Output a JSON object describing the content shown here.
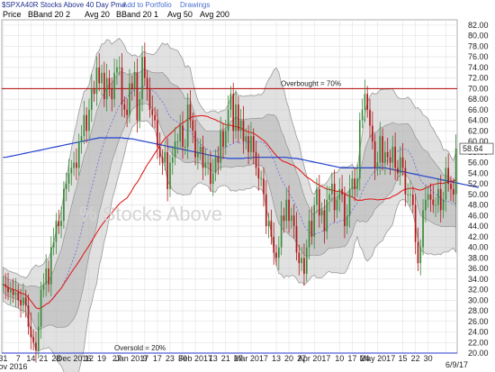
{
  "header": {
    "title": "$SPXA40R Stocks Above 40 Day Pma",
    "links": [
      "Add to Portfolio",
      "Drawings"
    ]
  },
  "legend": [
    {
      "label": "Price",
      "color": "#333333"
    },
    {
      "label": "BBand 20 2",
      "color": "#333333"
    },
    {
      "label": "Avg 20",
      "color": "#5b5bd6"
    },
    {
      "label": "BBand 20 1",
      "color": "#333333"
    },
    {
      "label": "Avg 50",
      "color": "#e02020"
    },
    {
      "label": "Avg 200",
      "color": "#2040d0"
    }
  ],
  "watermark": "% Stocks Above",
  "date_label": "6/9/17",
  "last_value_label": "58.64",
  "colors": {
    "up": "#3a8a3a",
    "down": "#b01818",
    "avg20": "#6a6ae0",
    "avg50": "#e02020",
    "avg200": "#2040d0",
    "ref_lines": "#b00000",
    "bottom_line": "#2a3ad0"
  },
  "chart_data": {
    "type": "candlestick",
    "title": "% Stocks Above 40 Day Pma",
    "x_ticks": [
      "31",
      "7",
      "14",
      "21",
      "28",
      "Dec 2016",
      "12",
      "19",
      "27",
      "Jan 2017",
      "9",
      "17",
      "23",
      "30",
      "Feb 2017",
      "13",
      "21",
      "27",
      "Mar 2017",
      "13",
      "20",
      "27",
      "Apr 2017",
      "10",
      "17",
      "24",
      "May 2017",
      "15",
      "22",
      "30",
      "6/9/17"
    ],
    "x_tick_index": [
      0,
      6,
      11,
      16,
      21,
      28,
      34,
      39,
      45,
      51,
      56,
      61,
      66,
      71,
      76,
      83,
      88,
      93,
      98,
      108,
      113,
      118,
      123,
      133,
      138,
      143,
      148,
      158,
      163,
      168,
      175
    ],
    "year_label": "Nov 2016",
    "y_ticks": [
      20,
      22,
      24,
      26,
      28,
      30,
      32,
      34,
      36,
      38,
      40,
      42,
      44,
      46,
      48,
      50,
      52,
      54,
      56,
      58,
      60,
      62,
      64,
      66,
      68,
      70,
      72,
      74,
      76,
      78,
      80,
      82
    ],
    "ylim": [
      20,
      83
    ],
    "reference_lines": [
      {
        "value": 70,
        "label": "Overbought = 70%"
      },
      {
        "value": 20,
        "label": "Oversold = 20%"
      }
    ],
    "last_value": 58.64,
    "closes": [
      33.0,
      32.5,
      31.5,
      32.0,
      31.0,
      31.5,
      30.0,
      29.0,
      30.5,
      29.0,
      25.0,
      23.0,
      22.0,
      20.5,
      25.0,
      32.0,
      33.0,
      36.0,
      33.0,
      40.0,
      41.0,
      45.0,
      44.0,
      45.0,
      51.0,
      52.0,
      54.0,
      55.0,
      56.0,
      55.0,
      60.0,
      61.0,
      65.0,
      62.0,
      66.0,
      70.0,
      69.0,
      74.0,
      71.0,
      73.0,
      68.0,
      72.0,
      70.0,
      68.0,
      73.0,
      74.0,
      74.0,
      67.0,
      66.0,
      65.0,
      71.0,
      70.0,
      73.0,
      64.0,
      68.0,
      76.0,
      72.0,
      70.0,
      66.0,
      65.0,
      64.0,
      59.0,
      57.0,
      56.0,
      58.0,
      51.0,
      56.0,
      57.0,
      60.0,
      60.0,
      63.0,
      59.0,
      59.0,
      67.0,
      64.0,
      62.0,
      57.0,
      58.0,
      59.0,
      55.0,
      56.0,
      56.0,
      52.0,
      54.0,
      57.0,
      56.0,
      62.0,
      59.0,
      62.0,
      66.0,
      69.0,
      62.0,
      67.0,
      62.0,
      64.0,
      60.0,
      61.0,
      58.0,
      61.0,
      58.0,
      55.0,
      53.0,
      53.0,
      50.0,
      44.0,
      45.0,
      42.0,
      39.0,
      38.0,
      40.0,
      46.0,
      45.0,
      49.0,
      45.0,
      46.0,
      44.0,
      39.0,
      37.0,
      38.0,
      35.0,
      40.0,
      45.0,
      42.0,
      48.0,
      51.0,
      46.0,
      47.0,
      43.0,
      49.0,
      50.0,
      52.0,
      47.0,
      49.0,
      51.0,
      50.0,
      44.0,
      46.0,
      51.0,
      53.0,
      51.0,
      53.0,
      64.0,
      66.0,
      69.0,
      66.0,
      63.0,
      60.0,
      55.0,
      56.0,
      61.0,
      56.0,
      58.0,
      57.0,
      56.0,
      59.0,
      55.0,
      54.0,
      57.0,
      55.0,
      50.0,
      50.0,
      50.0,
      48.0,
      41.0,
      37.0,
      40.0,
      47.0,
      49.0,
      50.0,
      49.0,
      48.0,
      48.0,
      51.0,
      47.0,
      49.0,
      55.0,
      52.0,
      51.0,
      50.0,
      58.64
    ],
    "avg200": [
      57.0,
      57.0,
      57.1,
      57.2,
      57.3,
      57.4,
      57.5,
      57.6,
      57.7,
      57.8,
      57.9,
      58.0,
      58.1,
      58.2,
      58.3,
      58.4,
      58.5,
      58.6,
      58.7,
      58.8,
      58.9,
      59.0,
      59.1,
      59.2,
      59.3,
      59.4,
      59.5,
      59.6,
      59.7,
      59.8,
      59.9,
      60.0,
      60.1,
      60.2,
      60.3,
      60.4,
      60.5,
      60.6,
      60.7,
      60.7,
      60.7,
      60.7,
      60.7,
      60.7,
      60.7,
      60.7,
      60.7,
      60.7,
      60.6,
      60.6,
      60.5,
      60.5,
      60.4,
      60.3,
      60.2,
      60.1,
      60.0,
      59.9,
      59.8,
      59.7,
      59.6,
      59.5,
      59.4,
      59.3,
      59.2,
      59.1,
      59.0,
      58.9,
      58.8,
      58.7,
      58.6,
      58.5,
      58.4,
      58.3,
      58.2,
      58.1,
      58.0,
      57.9,
      57.8,
      57.7,
      57.6,
      57.5,
      57.4,
      57.3,
      57.2,
      57.1,
      57.0,
      56.9,
      56.9,
      56.8,
      56.8,
      56.8,
      56.8,
      56.8,
      56.8,
      56.8,
      56.9,
      56.9,
      56.9,
      57.0,
      57.0,
      57.0,
      57.0,
      57.0,
      57.0,
      57.0,
      57.0,
      57.0,
      57.0,
      57.0,
      57.0,
      57.0,
      57.0,
      56.9,
      56.9,
      56.8,
      56.8,
      56.7,
      56.6,
      56.5,
      56.4,
      56.3,
      56.2,
      56.1,
      56.0,
      55.9,
      55.8,
      55.7,
      55.6,
      55.5,
      55.4,
      55.3,
      55.2,
      55.1,
      55.0,
      55.0,
      55.0,
      55.0,
      55.0,
      55.0,
      55.0,
      55.0,
      55.0,
      55.0,
      55.0,
      55.0,
      55.0,
      55.0,
      55.0,
      55.0,
      55.0,
      55.0,
      54.9,
      54.8,
      54.7,
      54.6,
      54.5,
      54.4,
      54.3,
      54.2,
      54.1,
      54.0,
      53.9,
      53.8,
      53.7,
      53.6,
      53.5,
      53.4,
      53.3,
      53.2,
      53.1,
      53.0,
      52.9,
      52.8,
      52.7,
      52.6,
      52.5,
      52.4,
      52.3,
      52.2,
      52.1,
      52.0,
      51.9,
      51.8,
      51.7,
      51.6,
      51.5,
      51.4,
      51.3
    ]
  }
}
